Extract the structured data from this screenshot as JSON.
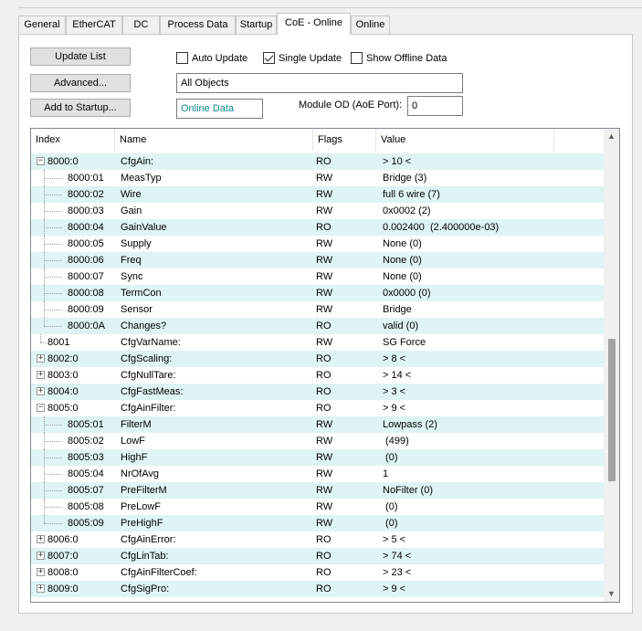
{
  "tabs": [
    {
      "label": "General",
      "active": false
    },
    {
      "label": "EtherCAT",
      "active": false
    },
    {
      "label": "DC",
      "active": false
    },
    {
      "label": "Process Data",
      "active": false
    },
    {
      "label": "Startup",
      "active": false
    },
    {
      "label": "CoE - Online",
      "active": true
    },
    {
      "label": "Online",
      "active": false
    }
  ],
  "buttons": {
    "update_list": "Update List",
    "advanced": "Advanced...",
    "add_to_startup": "Add to Startup..."
  },
  "checkboxes": {
    "auto_update": {
      "label": "Auto Update",
      "checked": false
    },
    "single_update": {
      "label": "Single Update",
      "checked": true
    },
    "show_offline": {
      "label": "Show Offline Data",
      "checked": false
    }
  },
  "fields": {
    "filter_value": "All Objects",
    "data_mode": "Online Data",
    "module_od_label": "Module OD (AoE Port):",
    "module_od_value": "0"
  },
  "colors": {
    "alt_row": "#dff4f4",
    "online_data_text": "#0e8a8a"
  },
  "table": {
    "columns": [
      "Index",
      "Name",
      "Flags",
      "Value"
    ],
    "rows": [
      {
        "index": "8000:0",
        "name": "CfgAin:",
        "flags": "RO",
        "value": "> 10 <",
        "level": 0,
        "expander": "minus"
      },
      {
        "index": "8000:01",
        "name": "MeasTyp",
        "flags": "RW",
        "value": "Bridge (3)",
        "level": 1
      },
      {
        "index": "8000:02",
        "name": "Wire",
        "flags": "RW",
        "value": "full 6 wire (7)",
        "level": 1
      },
      {
        "index": "8000:03",
        "name": "Gain",
        "flags": "RW",
        "value": "0x0002 (2)",
        "level": 1
      },
      {
        "index": "8000:04",
        "name": "GainValue",
        "flags": "RO",
        "value": "0.002400  (2.400000e-03)",
        "level": 1
      },
      {
        "index": "8000:05",
        "name": "Supply",
        "flags": "RW",
        "value": "None (0)",
        "level": 1
      },
      {
        "index": "8000:06",
        "name": "Freq",
        "flags": "RW",
        "value": "None (0)",
        "level": 1
      },
      {
        "index": "8000:07",
        "name": "Sync",
        "flags": "RW",
        "value": "None (0)",
        "level": 1
      },
      {
        "index": "8000:08",
        "name": "TermCon",
        "flags": "RW",
        "value": "0x0000 (0)",
        "level": 1
      },
      {
        "index": "8000:09",
        "name": "Sensor",
        "flags": "RW",
        "value": "Bridge",
        "level": 1
      },
      {
        "index": "8000:0A",
        "name": "Changes?",
        "flags": "RO",
        "value": "valid (0)",
        "level": 1,
        "last": true
      },
      {
        "index": "8001",
        "name": "CfgVarName:",
        "flags": "RW",
        "value": "SG Force",
        "level": 0,
        "expander": "none"
      },
      {
        "index": "8002:0",
        "name": "CfgScaling:",
        "flags": "RO",
        "value": "> 8 <",
        "level": 0,
        "expander": "plus"
      },
      {
        "index": "8003:0",
        "name": "CfgNullTare:",
        "flags": "RO",
        "value": "> 14 <",
        "level": 0,
        "expander": "plus"
      },
      {
        "index": "8004:0",
        "name": "CfgFastMeas:",
        "flags": "RO",
        "value": "> 3 <",
        "level": 0,
        "expander": "plus"
      },
      {
        "index": "8005:0",
        "name": "CfgAinFilter:",
        "flags": "RO",
        "value": "> 9 <",
        "level": 0,
        "expander": "minus"
      },
      {
        "index": "8005:01",
        "name": "FilterM",
        "flags": "RW",
        "value": "Lowpass (2)",
        "level": 1
      },
      {
        "index": "8005:02",
        "name": "LowF",
        "flags": "RW",
        "value": " (499)",
        "level": 1
      },
      {
        "index": "8005:03",
        "name": "HighF",
        "flags": "RW",
        "value": " (0)",
        "level": 1
      },
      {
        "index": "8005:04",
        "name": "NrOfAvg",
        "flags": "RW",
        "value": "1",
        "level": 1
      },
      {
        "index": "8005:07",
        "name": "PreFilterM",
        "flags": "RW",
        "value": "NoFilter (0)",
        "level": 1
      },
      {
        "index": "8005:08",
        "name": "PreLowF",
        "flags": "RW",
        "value": " (0)",
        "level": 1
      },
      {
        "index": "8005:09",
        "name": "PreHighF",
        "flags": "RW",
        "value": " (0)",
        "level": 1,
        "last": true
      },
      {
        "index": "8006:0",
        "name": "CfgAinError:",
        "flags": "RO",
        "value": "> 5 <",
        "level": 0,
        "expander": "plus"
      },
      {
        "index": "8007:0",
        "name": "CfgLinTab:",
        "flags": "RO",
        "value": "> 74 <",
        "level": 0,
        "expander": "plus"
      },
      {
        "index": "8008:0",
        "name": "CfgAinFilterCoef:",
        "flags": "RO",
        "value": "> 23 <",
        "level": 0,
        "expander": "plus"
      },
      {
        "index": "8009:0",
        "name": "CfgSigPro:",
        "flags": "RO",
        "value": "> 9 <",
        "level": 0,
        "expander": "plus"
      }
    ]
  },
  "scrollbar": {
    "up_icon": "▲",
    "down_icon": "▼"
  }
}
